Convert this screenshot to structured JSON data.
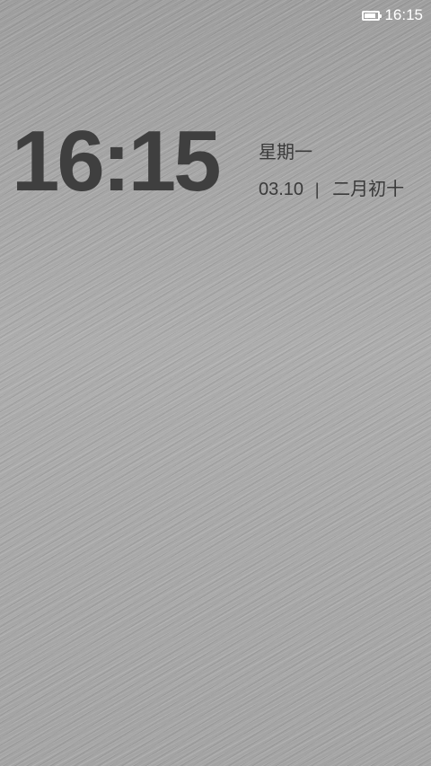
{
  "status_bar": {
    "time": "16:15",
    "battery_icon": "battery-icon",
    "battery_level": 0.85
  },
  "lock_screen": {
    "clock": "16:15",
    "weekday": "星期一",
    "date": "03.10",
    "separator": "|",
    "lunar_date": "二月初十"
  },
  "colors": {
    "background": "#a6a6a6",
    "clock_text": "#3f3f3f",
    "status_text": "#ffffff"
  }
}
